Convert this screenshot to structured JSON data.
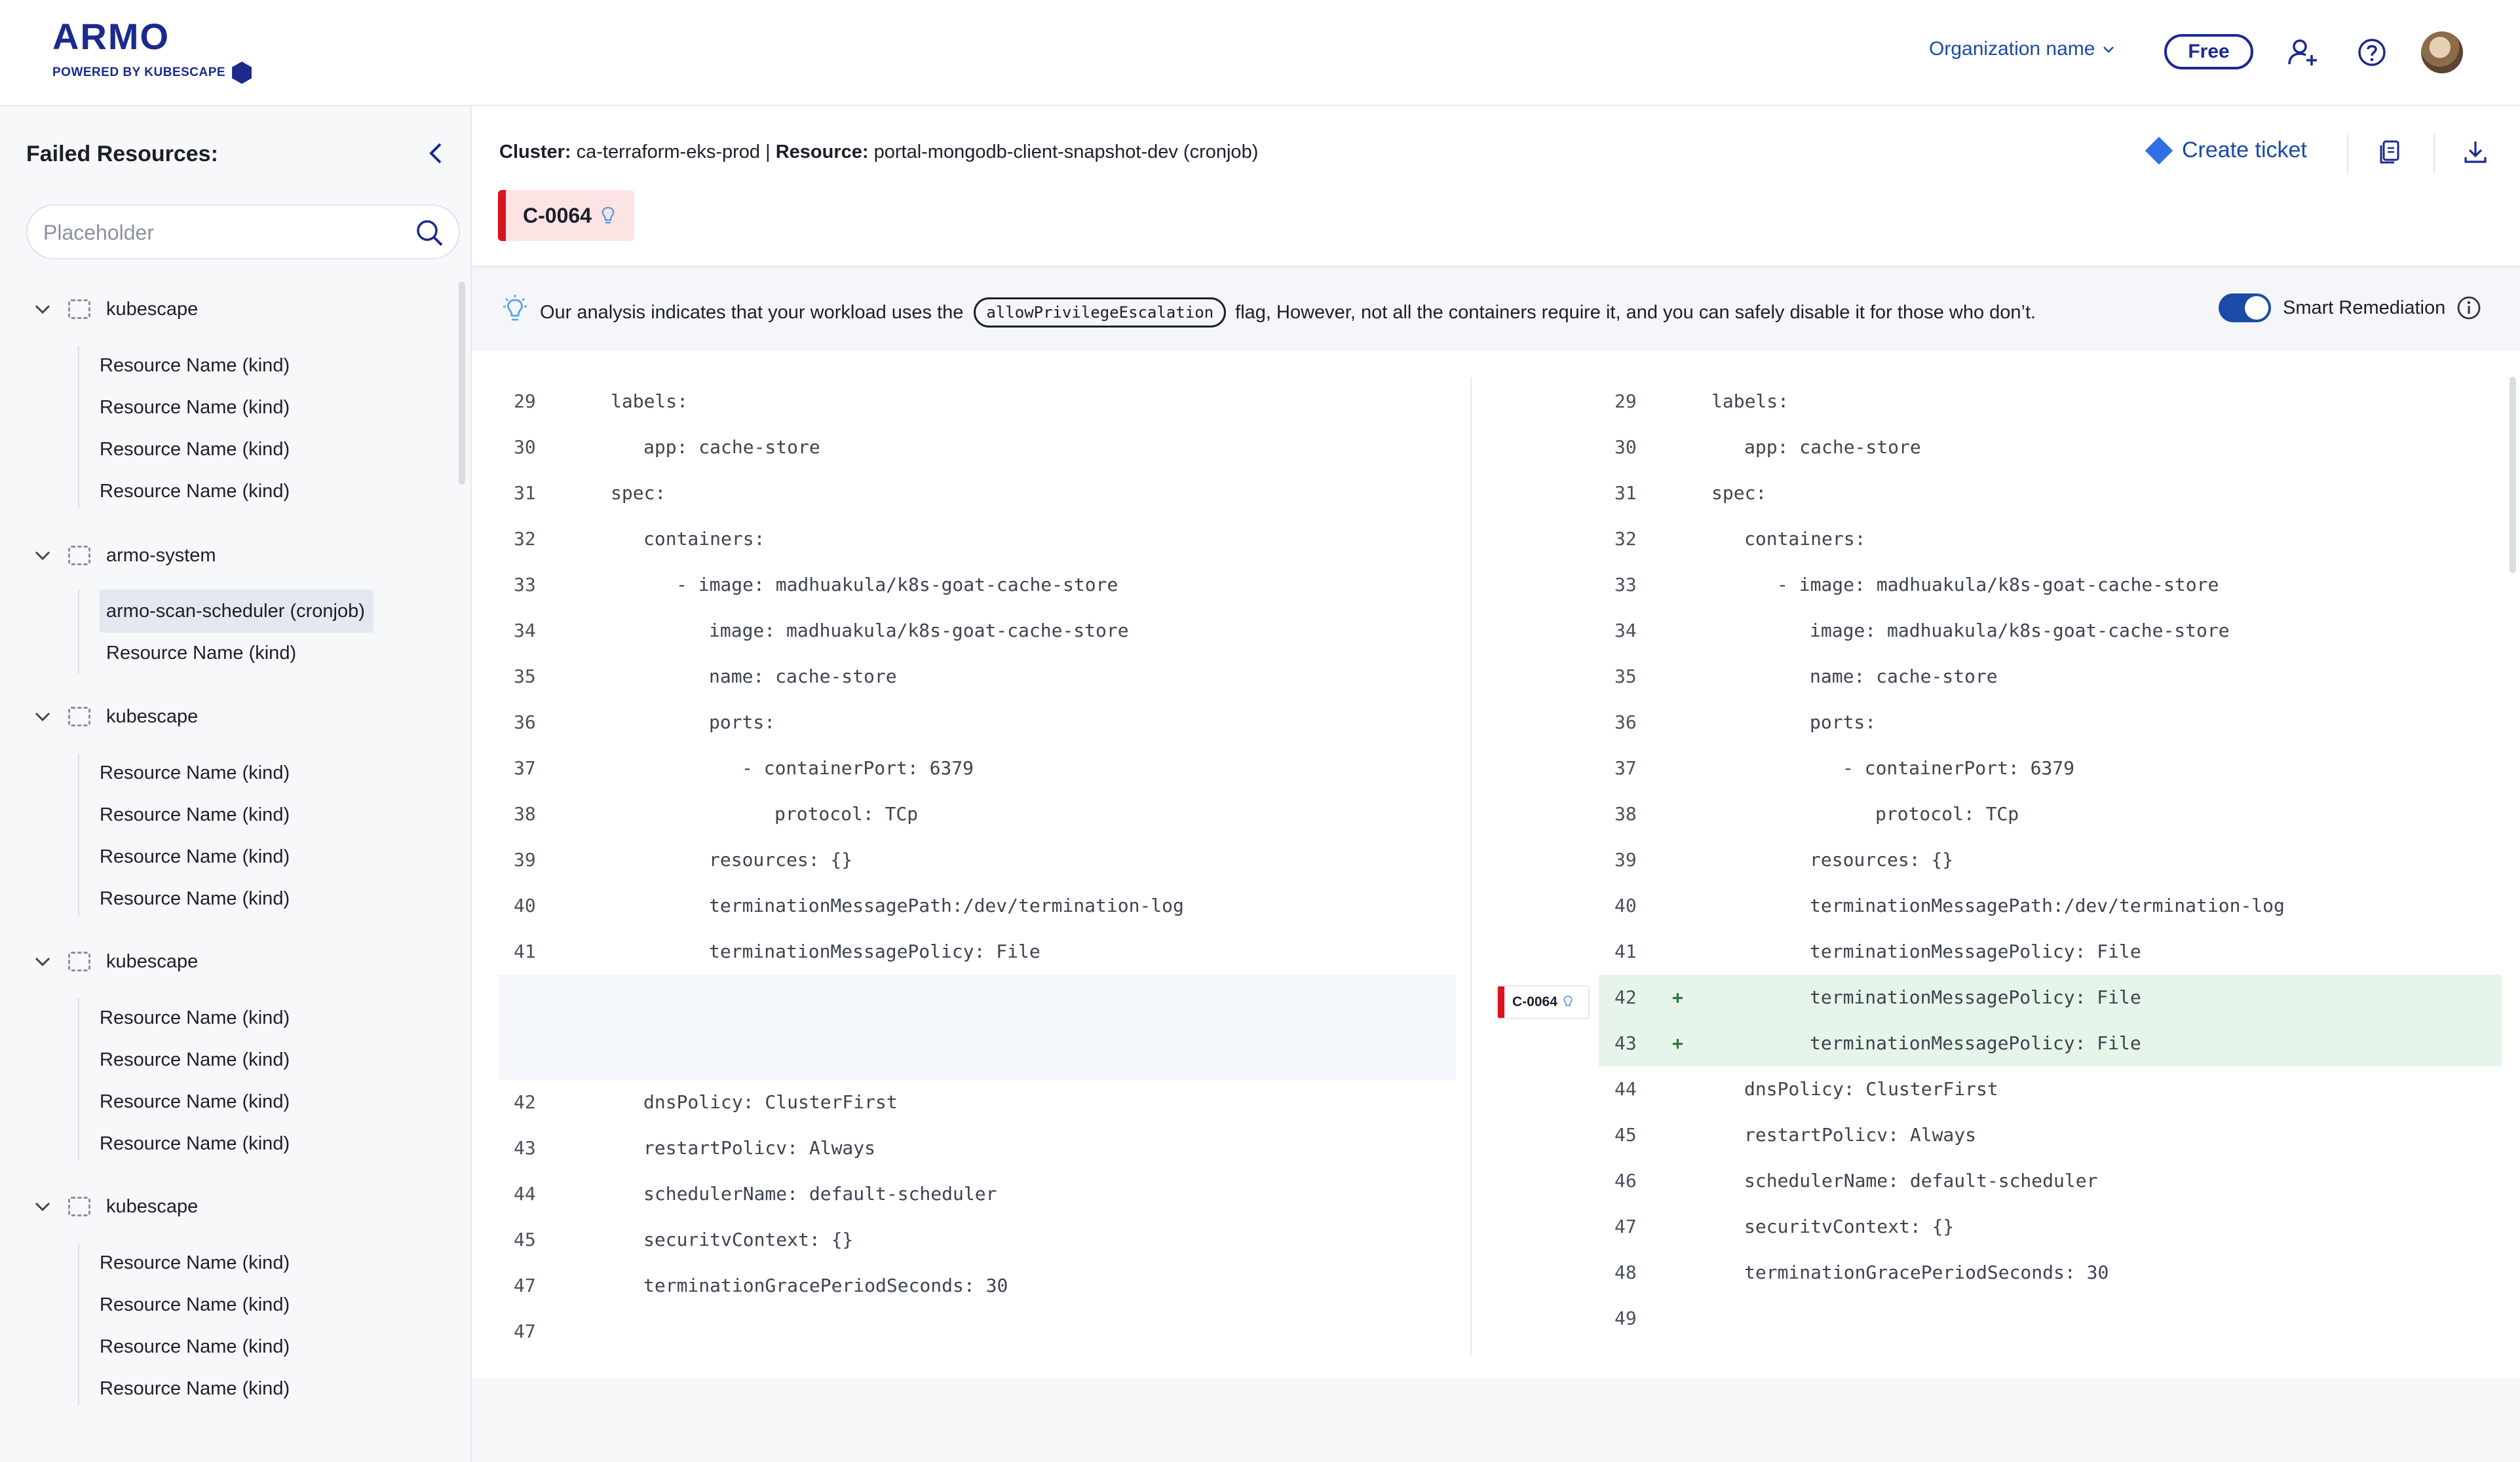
{
  "header": {
    "logo": "ARMO",
    "logo_sub": "POWERED BY KUBESCAPE",
    "org_name": "Organization name",
    "plan_badge": "Free"
  },
  "sidebar": {
    "title": "Failed Resources:",
    "search_placeholder": "Placeholder",
    "groups": [
      {
        "name": "kubescape",
        "items": [
          "Resource Name (kind)",
          "Resource Name (kind)",
          "Resource Name (kind)",
          "Resource Name (kind)"
        ]
      },
      {
        "name": "armo-system",
        "items": [
          "armo-scan-scheduler (cronjob)",
          "Resource Name (kind)"
        ]
      },
      {
        "name": "kubescape",
        "items": [
          "Resource Name (kind)",
          "Resource Name (kind)",
          "Resource Name (kind)",
          "Resource Name (kind)"
        ]
      },
      {
        "name": "kubescape",
        "items": [
          "Resource Name (kind)",
          "Resource Name (kind)",
          "Resource Name (kind)",
          "Resource Name (kind)"
        ]
      },
      {
        "name": "kubescape",
        "items": [
          "Resource Name (kind)",
          "Resource Name (kind)",
          "Resource Name (kind)",
          "Resource Name (kind)"
        ]
      }
    ]
  },
  "resource_header": {
    "cluster_label": "Cluster:",
    "cluster_value": "ca-terraform-eks-prod",
    "separator": "|",
    "resource_label": "Resource:",
    "resource_value": "portal-mongodb-client-snapshot-dev (cronjob)",
    "create_ticket": "Create ticket",
    "control_id": "C-0064"
  },
  "banner": {
    "text_before": "Our analysis indicates that your workload uses the",
    "flag": "allowPrivilegeEscalation",
    "text_after": "flag, However, not all the containers require it, and you can safely disable it for those who don’t.",
    "toggle_label": "Smart Remediation",
    "toggle_on": true
  },
  "left_code": [
    {
      "n": "29",
      "code": "labels:"
    },
    {
      "n": "30",
      "code": "  app: cache-store"
    },
    {
      "n": "31",
      "code": "spec:"
    },
    {
      "n": "32",
      "code": "  containers:"
    },
    {
      "n": "33",
      "code": "    - image: madhuakula/k8s-goat-cache-store"
    },
    {
      "n": "34",
      "code": "      image: madhuakula/k8s-goat-cache-store"
    },
    {
      "n": "35",
      "code": "      name: cache-store"
    },
    {
      "n": "36",
      "code": "      ports:"
    },
    {
      "n": "37",
      "code": "        - containerPort: 6379"
    },
    {
      "n": "38",
      "code": "          protocol: TCp"
    },
    {
      "n": "39",
      "code": "      resources: {}"
    },
    {
      "n": "40",
      "code": "      terminationMessagePath:/dev/termination-log"
    },
    {
      "n": "41",
      "code": "      terminationMessagePolicy: File"
    },
    {
      "n": "42",
      "code": "  dnsPolicy: ClusterFirst"
    },
    {
      "n": "43",
      "code": "  restartPolicv: Always"
    },
    {
      "n": "44",
      "code": "  schedulerName: default-scheduler"
    },
    {
      "n": "45",
      "code": "  securitvContext: {}"
    },
    {
      "n": "47",
      "code": "  terminationGracePeriodSeconds: 30"
    },
    {
      "n": "47",
      "code": ""
    }
  ],
  "right_code": [
    {
      "n": "29",
      "code": "labels:"
    },
    {
      "n": "30",
      "code": "  app: cache-store"
    },
    {
      "n": "31",
      "code": "spec:"
    },
    {
      "n": "32",
      "code": "  containers:"
    },
    {
      "n": "33",
      "code": "    - image: madhuakula/k8s-goat-cache-store"
    },
    {
      "n": "34",
      "code": "      image: madhuakula/k8s-goat-cache-store"
    },
    {
      "n": "35",
      "code": "      name: cache-store"
    },
    {
      "n": "36",
      "code": "      ports:"
    },
    {
      "n": "37",
      "code": "        - containerPort: 6379"
    },
    {
      "n": "38",
      "code": "          protocol: TCp"
    },
    {
      "n": "39",
      "code": "      resources: {}"
    },
    {
      "n": "40",
      "code": "      terminationMessagePath:/dev/termination-log"
    },
    {
      "n": "41",
      "code": "      terminationMessagePolicy: File"
    },
    {
      "n": "42",
      "code": "      terminationMessagePolicy: File",
      "added": true
    },
    {
      "n": "43",
      "code": "      terminationMessagePolicy: File",
      "added": true
    },
    {
      "n": "44",
      "code": "  dnsPolicy: ClusterFirst"
    },
    {
      "n": "45",
      "code": "  restartPolicv: Always"
    },
    {
      "n": "46",
      "code": "  schedulerName: default-scheduler"
    },
    {
      "n": "47",
      "code": "  securitvContext: {}"
    },
    {
      "n": "48",
      "code": "  terminationGracePeriodSeconds: 30"
    },
    {
      "n": "49",
      "code": ""
    }
  ],
  "added_marker": "+",
  "colors": {
    "brand": "#1b2a8c",
    "accent": "#1b4aa8",
    "control_red": "#d8151d",
    "added_bg": "#e6f4e9"
  }
}
